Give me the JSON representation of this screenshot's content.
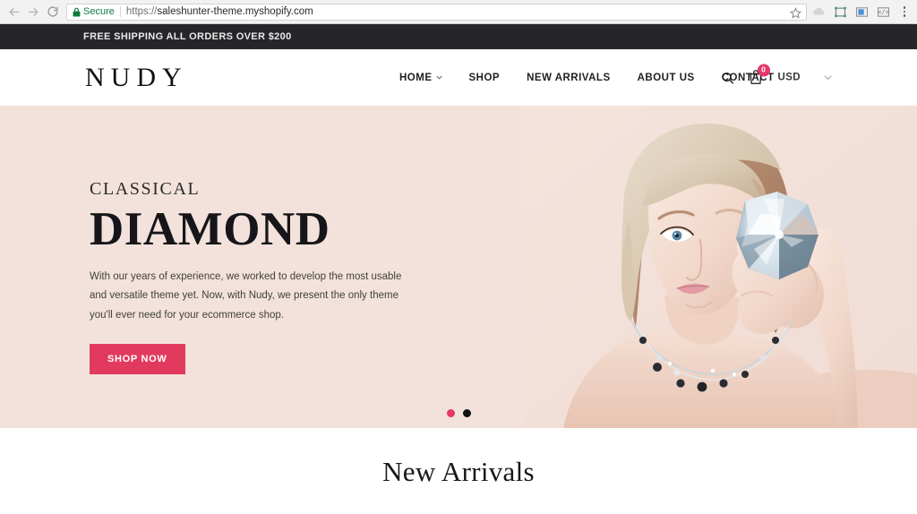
{
  "browser": {
    "back_icon": "arrow-left-icon",
    "forward_icon": "arrow-right-icon",
    "reload_icon": "reload-icon",
    "security_label": "Secure",
    "lock_icon": "lock-icon",
    "url_scheme": "https://",
    "url_host": "saleshunter-theme.myshopify.com",
    "bookmark_icon": "star-icon",
    "extensions": [
      "cloud-icon",
      "crop-frame-icon",
      "panel-icon",
      "code-icon"
    ],
    "menu_icon": "kebab-menu-icon"
  },
  "announcement": {
    "text": "FREE SHIPPING ALL ORDERS OVER $200",
    "bg": "#26262a",
    "fg": "#e9e9e9"
  },
  "header": {
    "logo": "NUDY",
    "nav": [
      {
        "label": "HOME",
        "has_chevron": true
      },
      {
        "label": "SHOP",
        "has_chevron": false
      },
      {
        "label": "NEW ARRIVALS",
        "has_chevron": false
      },
      {
        "label": "ABOUT US",
        "has_chevron": false
      },
      {
        "label": "CONTACT",
        "has_chevron": false
      }
    ],
    "search_icon": "search-icon",
    "cart_icon": "shopping-bag-icon",
    "cart_count": "0",
    "cart_badge_color": "#e6366a",
    "currency": "USD",
    "currency_chevron_icon": "chevron-down-icon"
  },
  "hero": {
    "eyebrow": "CLASSICAL",
    "title": "DIAMOND",
    "paragraph": "With our years of experience, we worked to develop the most usable and versatile theme yet. Now, with Nudy, we present the only theme you'll ever need for your ecommerce shop.",
    "cta_label": "SHOP NOW",
    "cta_color": "#e23a5e",
    "background": "#f3e2db",
    "image_alt": "blonde model holding a large diamond over her eye wearing a silver necklace",
    "carousel": {
      "slides": 2,
      "active_index": 0,
      "active_color": "#e6366a",
      "inactive_color": "#111114"
    }
  },
  "section": {
    "arrivals_title": "New Arrivals"
  }
}
